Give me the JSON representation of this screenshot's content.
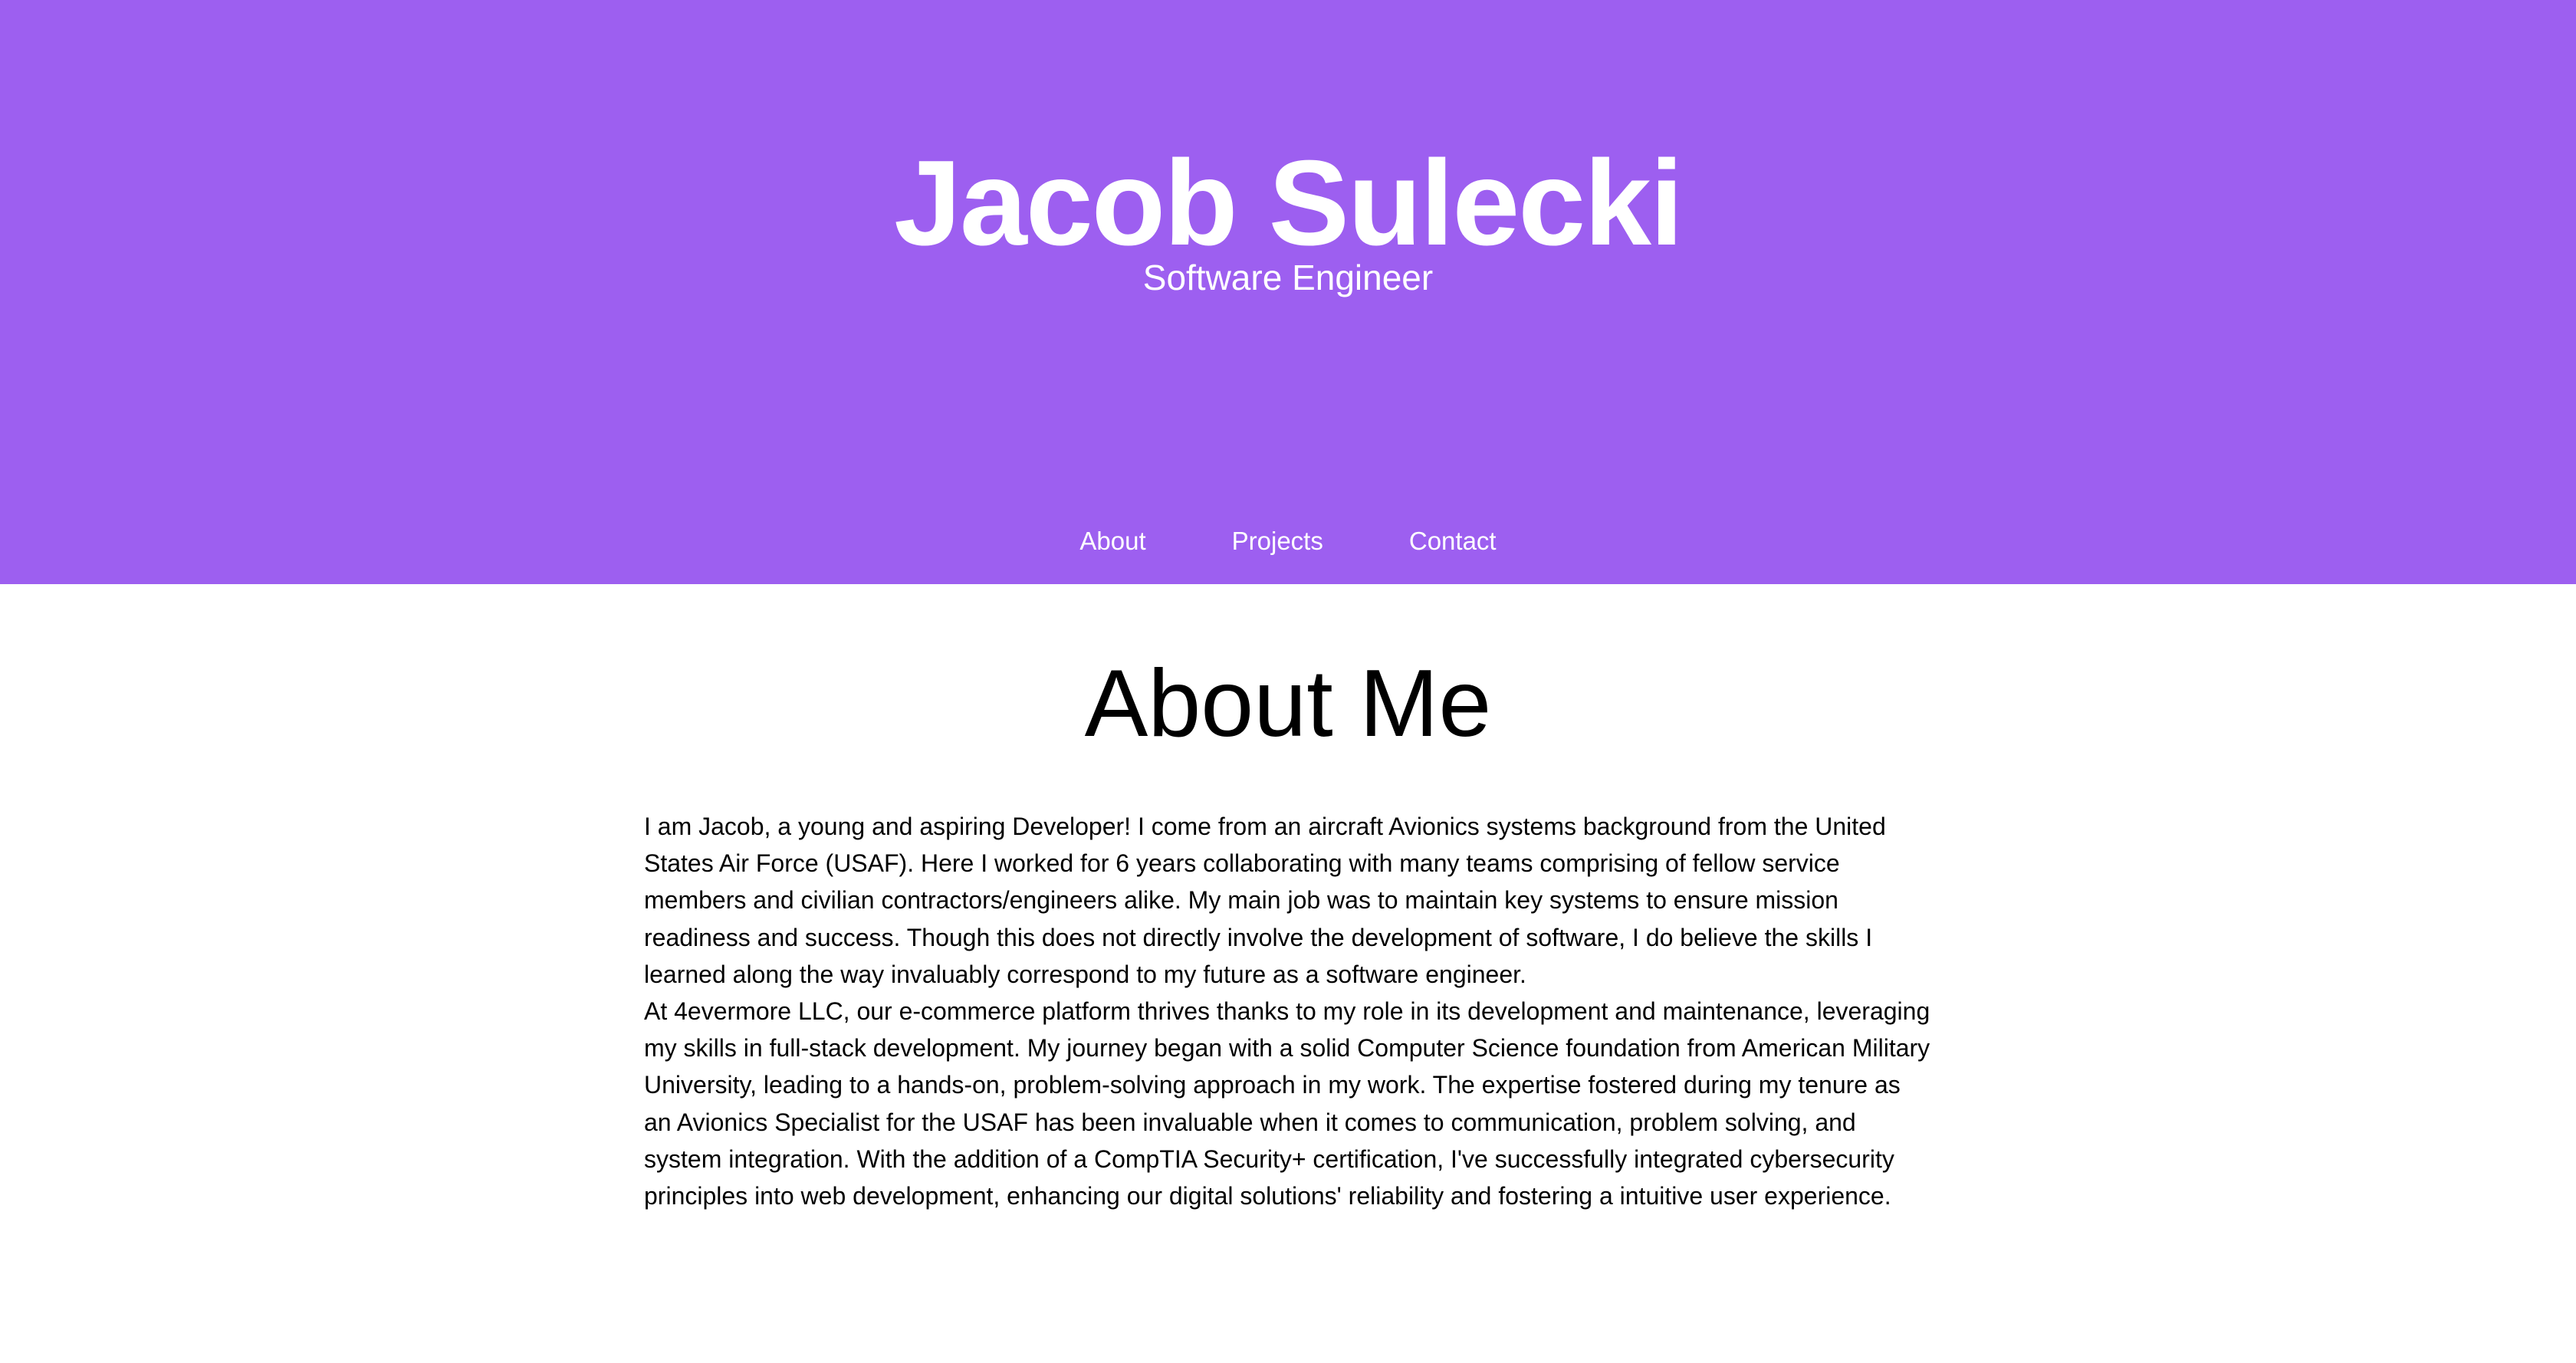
{
  "header": {
    "name": "Jacob Sulecki",
    "subtitle": "Software Engineer"
  },
  "nav": {
    "items": [
      {
        "label": "About"
      },
      {
        "label": "Projects"
      },
      {
        "label": "Contact"
      }
    ]
  },
  "about": {
    "title": "About Me",
    "paragraphs": [
      "I am Jacob, a young and aspiring Developer! I come from an aircraft Avionics systems background from the United States Air Force (USAF). Here I worked for 6 years collaborating with many teams comprising of fellow service members and civilian contractors/engineers alike. My main job was to maintain key systems to ensure mission readiness and success. Though this does not directly involve the development of software, I do believe the skills I learned along the way invaluably correspond to my future as a software engineer.",
      "At 4evermore LLC, our e-commerce platform thrives thanks to my role in its development and maintenance, leveraging my skills in full-stack development. My journey began with a solid Computer Science foundation from American Military University, leading to a hands-on, problem-solving approach in my work. The expertise fostered during my tenure as an Avionics Specialist for the USAF has been invaluable when it comes to communication, problem solving, and system integration. With the addition of a CompTIA Security+ certification, I've successfully integrated cybersecurity principles into web development, enhancing our digital solutions' reliability and fostering a intuitive user experience."
    ]
  },
  "colors": {
    "hero_background": "#9d5ff0",
    "hero_text": "#ffffff",
    "body_text": "#000000"
  }
}
